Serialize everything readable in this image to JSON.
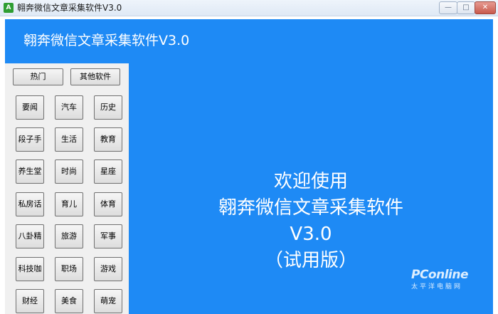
{
  "window": {
    "app_icon_text": "A",
    "title": "翱奔微信文章采集软件V3.0",
    "minimize_glyph": "—",
    "maximize_glyph": "□",
    "close_glyph": "✕"
  },
  "header": {
    "title": "翱奔微信文章采集软件V3.0"
  },
  "tabs": {
    "hot": "热门",
    "other_software": "其他软件"
  },
  "categories": [
    "要闻",
    "汽车",
    "历史",
    "段子手",
    "生活",
    "教育",
    "养生堂",
    "时尚",
    "星座",
    "私房话",
    "育儿",
    "体育",
    "八卦精",
    "旅游",
    "军事",
    "科技咖",
    "职场",
    "游戏",
    "财经",
    "美食",
    "萌宠"
  ],
  "main": {
    "line1": "欢迎使用",
    "line2": "翱奔微信文章采集软件",
    "line3": "V3.0",
    "line4": "（试用版）"
  },
  "watermark": {
    "main": "PConline",
    "sub": "太平洋电脑网"
  },
  "colors": {
    "accent": "#1e8af5",
    "panel": "#f0f0f0"
  }
}
